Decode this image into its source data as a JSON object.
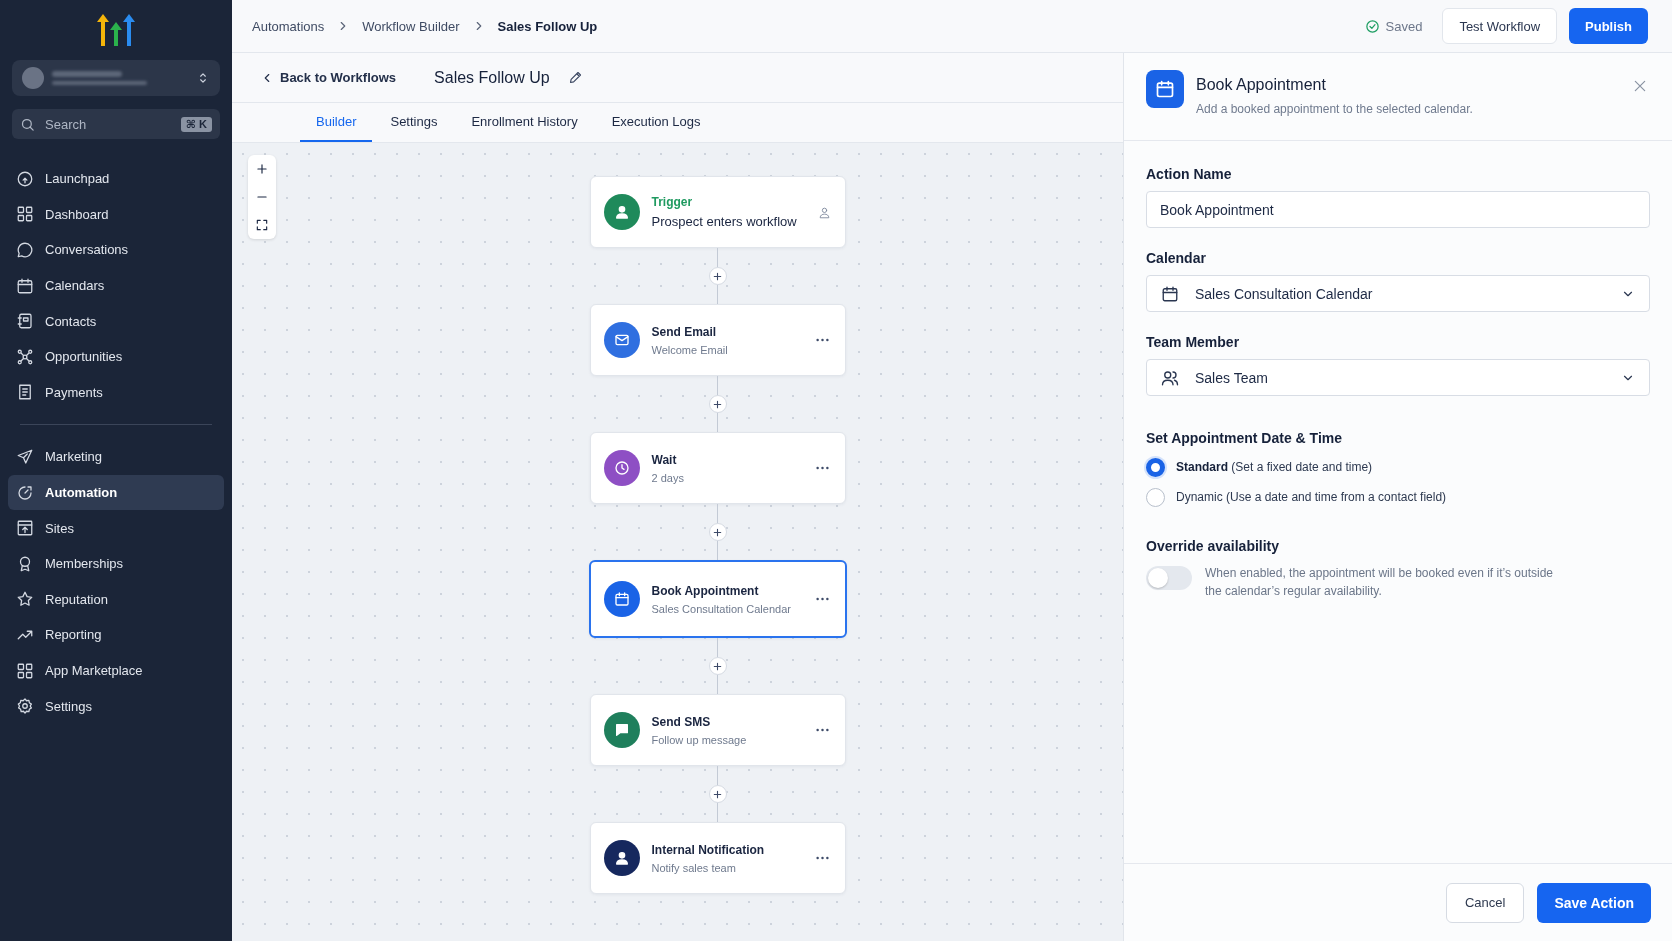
{
  "sidebar": {
    "account": {
      "blurred": true
    },
    "search": {
      "placeholder": "Search",
      "shortcut": "⌘ K"
    },
    "groups": [
      [
        {
          "kind": "launchpad",
          "label": "Launchpad",
          "selected": false
        },
        {
          "kind": "grid",
          "label": "Dashboard",
          "selected": false
        },
        {
          "kind": "chat",
          "label": "Conversations",
          "selected": false
        },
        {
          "kind": "calendar",
          "label": "Calendars",
          "selected": false
        },
        {
          "kind": "contacts",
          "label": "Contacts",
          "selected": false
        },
        {
          "kind": "opportunities",
          "label": "Opportunities",
          "selected": false
        },
        {
          "kind": "payments",
          "label": "Payments",
          "selected": false
        }
      ],
      [
        {
          "kind": "send",
          "label": "Marketing",
          "selected": false
        },
        {
          "kind": "automation",
          "label": "Automation",
          "selected": true
        },
        {
          "kind": "sites",
          "label": "Sites",
          "selected": false
        },
        {
          "kind": "badge",
          "label": "Memberships",
          "selected": false
        },
        {
          "kind": "star",
          "label": "Reputation",
          "selected": false
        },
        {
          "kind": "trend",
          "label": "Reporting",
          "selected": false
        },
        {
          "kind": "grid",
          "label": "App Marketplace",
          "selected": false
        },
        {
          "kind": "gear",
          "label": "Settings",
          "selected": false
        }
      ]
    ]
  },
  "breadcrumbs": [
    {
      "label": "Automations",
      "current": false
    },
    {
      "label": "Workflow Builder",
      "current": false
    },
    {
      "label": "Sales Follow Up",
      "current": true
    }
  ],
  "header_actions": {
    "saved": "Saved",
    "test_button": "Test Workflow",
    "publish_button": "Publish"
  },
  "workflow_bar": {
    "back": "Back to Workflows",
    "title": "Sales Follow Up"
  },
  "tabs": [
    {
      "label": "Builder",
      "selected": true
    },
    {
      "label": "Settings",
      "selected": false
    },
    {
      "label": "Enrollment History",
      "selected": false
    },
    {
      "label": "Execution Logs",
      "selected": false
    }
  ],
  "nodes": [
    {
      "kind": "trigger",
      "title": "Trigger",
      "subtitle": "Prospect enters workflow",
      "color": "#1f8a5b",
      "selected": false
    },
    {
      "kind": "email",
      "title": "Send Email",
      "subtitle": "Welcome Email",
      "color": "#2f6fe0",
      "selected": false
    },
    {
      "kind": "wait",
      "title": "Wait",
      "subtitle": "2 days",
      "color": "#8e4fc4",
      "selected": false
    },
    {
      "kind": "appointment",
      "title": "Book Appointment",
      "subtitle": "Sales Consultation Calendar",
      "color": "#1a63e6",
      "selected": true
    },
    {
      "kind": "sms",
      "title": "Send SMS",
      "subtitle": "Follow up message",
      "color": "#1f7f5c",
      "selected": false
    },
    {
      "kind": "notification",
      "title": "Internal Notification",
      "subtitle": "Notify sales team",
      "color": "#16285e",
      "selected": false
    }
  ],
  "panel": {
    "title": "Book Appointment",
    "description": "Add a booked appointment to the selected calendar.",
    "action_name": {
      "label": "Action Name",
      "value": "Book Appointment"
    },
    "calendar": {
      "label": "Calendar",
      "value": "Sales Consultation Calendar"
    },
    "team_member": {
      "label": "Team Member",
      "value": "Sales Team"
    },
    "date_time": {
      "label": "Set Appointment Date & Time",
      "options": [
        {
          "text": "**Standard** (Set a fixed date and time)",
          "selected": true
        },
        {
          "text": "Dynamic (Use a date and time from a contact field)",
          "selected": false
        }
      ]
    },
    "override": {
      "label": "Override availability",
      "on": false,
      "description": "When enabled, the appointment will be booked even if it’s outside the calendar’s regular availability."
    },
    "cancel_button": "Cancel",
    "save_button": "Save Action"
  }
}
